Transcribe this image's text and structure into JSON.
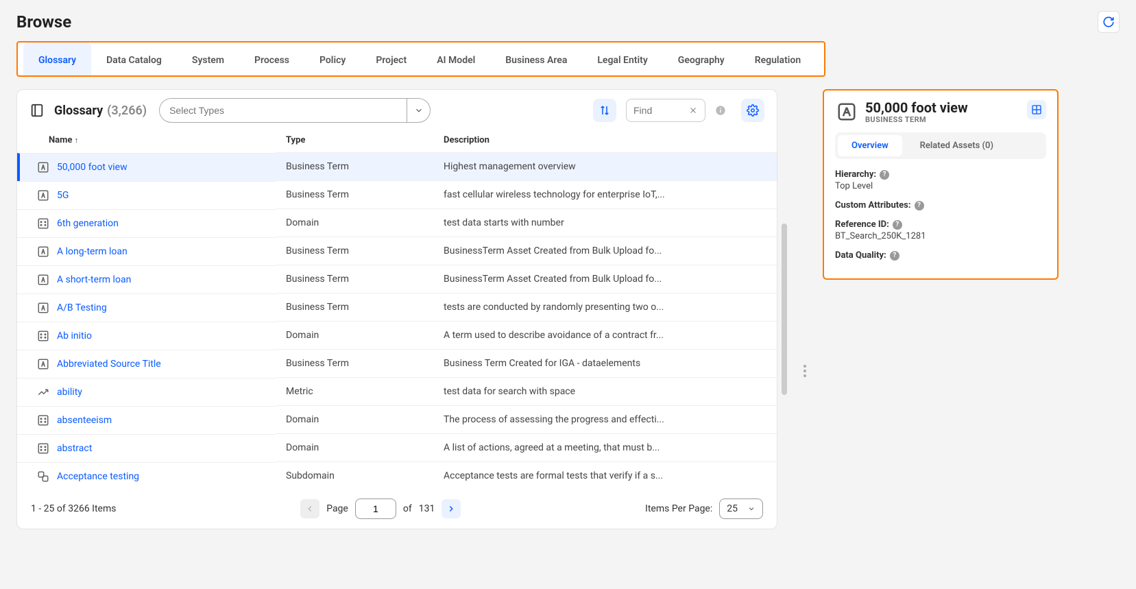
{
  "page": {
    "title": "Browse"
  },
  "tabs": [
    {
      "label": "Glossary",
      "active": true
    },
    {
      "label": "Data Catalog"
    },
    {
      "label": "System"
    },
    {
      "label": "Process"
    },
    {
      "label": "Policy"
    },
    {
      "label": "Project"
    },
    {
      "label": "AI Model"
    },
    {
      "label": "Business Area"
    },
    {
      "label": "Legal Entity"
    },
    {
      "label": "Geography"
    },
    {
      "label": "Regulation"
    }
  ],
  "section": {
    "title": "Glossary",
    "count": "(3,266)",
    "typeSelectPlaceholder": "Select Types",
    "findPlaceholder": "Find"
  },
  "columns": {
    "name": "Name",
    "type": "Type",
    "description": "Description"
  },
  "rows": [
    {
      "icon": "bt",
      "name": "50,000 foot view",
      "type": "Business Term",
      "desc": "Highest management overview",
      "selected": true
    },
    {
      "icon": "bt",
      "name": "5G",
      "type": "Business Term",
      "desc": "fast cellular wireless technology for enterprise IoT,..."
    },
    {
      "icon": "dom",
      "name": "6th generation",
      "type": "Domain",
      "desc": "test data starts with number"
    },
    {
      "icon": "bt",
      "name": "A long-term loan",
      "type": "Business Term",
      "desc": "BusinessTerm Asset Created from Bulk Upload fo..."
    },
    {
      "icon": "bt",
      "name": "A short-term loan",
      "type": "Business Term",
      "desc": "BusinessTerm Asset Created from Bulk Upload fo..."
    },
    {
      "icon": "bt",
      "name": "A/B Testing",
      "type": "Business Term",
      "desc": "tests are conducted by randomly presenting two o..."
    },
    {
      "icon": "dom",
      "name": "Ab initio",
      "type": "Domain",
      "desc": "A term used to describe avoidance of a contract fr..."
    },
    {
      "icon": "bt",
      "name": "Abbreviated Source Title",
      "type": "Business Term",
      "desc": "Business Term Created for IGA - dataelements"
    },
    {
      "icon": "metric",
      "name": "ability",
      "type": "Metric",
      "desc": "test data for search with space"
    },
    {
      "icon": "dom",
      "name": "absenteeism",
      "type": "Domain",
      "desc": "The process of assessing the progress and effecti..."
    },
    {
      "icon": "dom",
      "name": "abstract",
      "type": "Domain",
      "desc": "A list of actions, agreed at a meeting, that must b..."
    },
    {
      "icon": "sub",
      "name": "Acceptance testing",
      "type": "Subdomain",
      "desc": "Acceptance tests are formal tests that verify if a s..."
    }
  ],
  "paginator": {
    "range": "1 - 25 of 3266 Items",
    "pageLabel": "Page",
    "page": "1",
    "ofLabel": "of",
    "totalPages": "131",
    "ippLabel": "Items Per Page:",
    "ipp": "25"
  },
  "detail": {
    "title": "50,000 foot view",
    "subtitle": "BUSINESS TERM",
    "tabs": {
      "overview": "Overview",
      "related": "Related Assets (0)"
    },
    "fields": {
      "hierarchyLabel": "Hierarchy:",
      "hierarchyValue": "Top Level",
      "customAttrLabel": "Custom Attributes:",
      "refIdLabel": "Reference ID:",
      "refIdValue": "BT_Search_250K_1281",
      "dqLabel": "Data Quality:"
    }
  }
}
